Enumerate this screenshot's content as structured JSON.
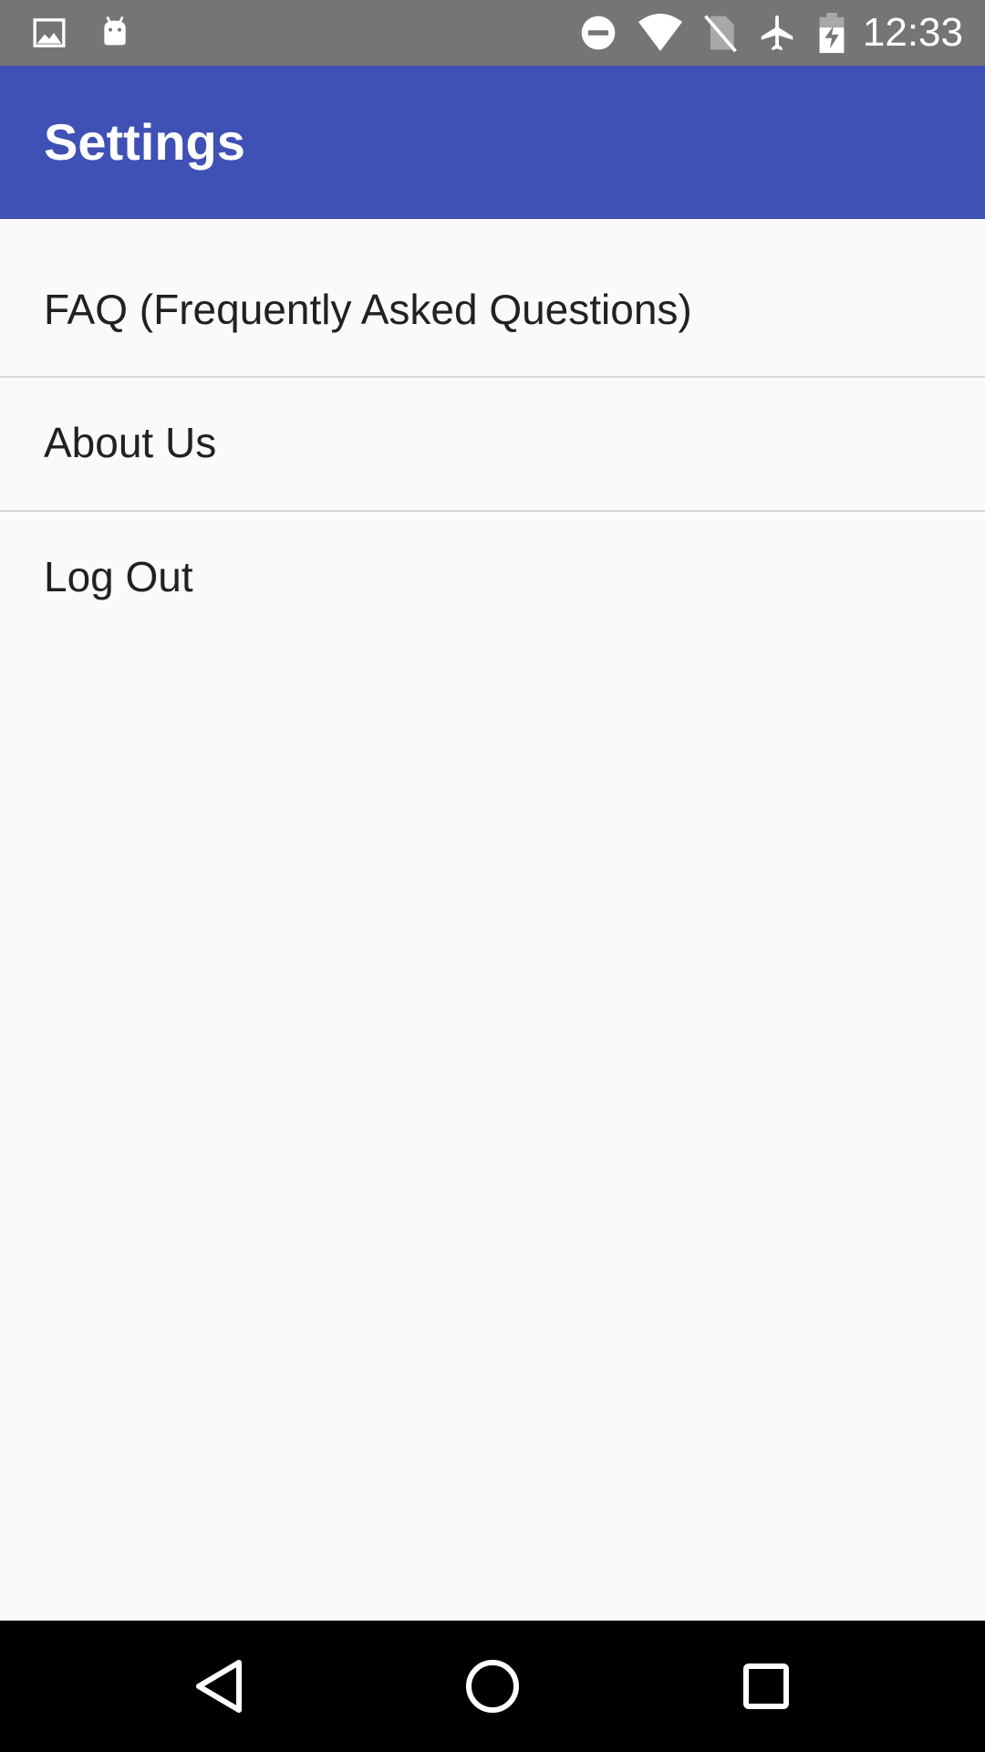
{
  "status_bar": {
    "time": "12:33",
    "left_icons": [
      "image-icon",
      "android-icon"
    ],
    "right_icons": [
      "do-not-disturb-icon",
      "wifi-icon",
      "no-sim-icon",
      "airplane-mode-icon",
      "battery-charging-icon"
    ],
    "background_color": "#757575"
  },
  "app_bar": {
    "title": "Settings",
    "background_color": "#3f51b5"
  },
  "settings": {
    "items": [
      {
        "label": "FAQ (Frequently Asked Questions)"
      },
      {
        "label": "About Us"
      },
      {
        "label": "Log Out"
      }
    ]
  },
  "nav_bar": {
    "buttons": [
      "back-icon",
      "home-icon",
      "recents-icon"
    ]
  }
}
